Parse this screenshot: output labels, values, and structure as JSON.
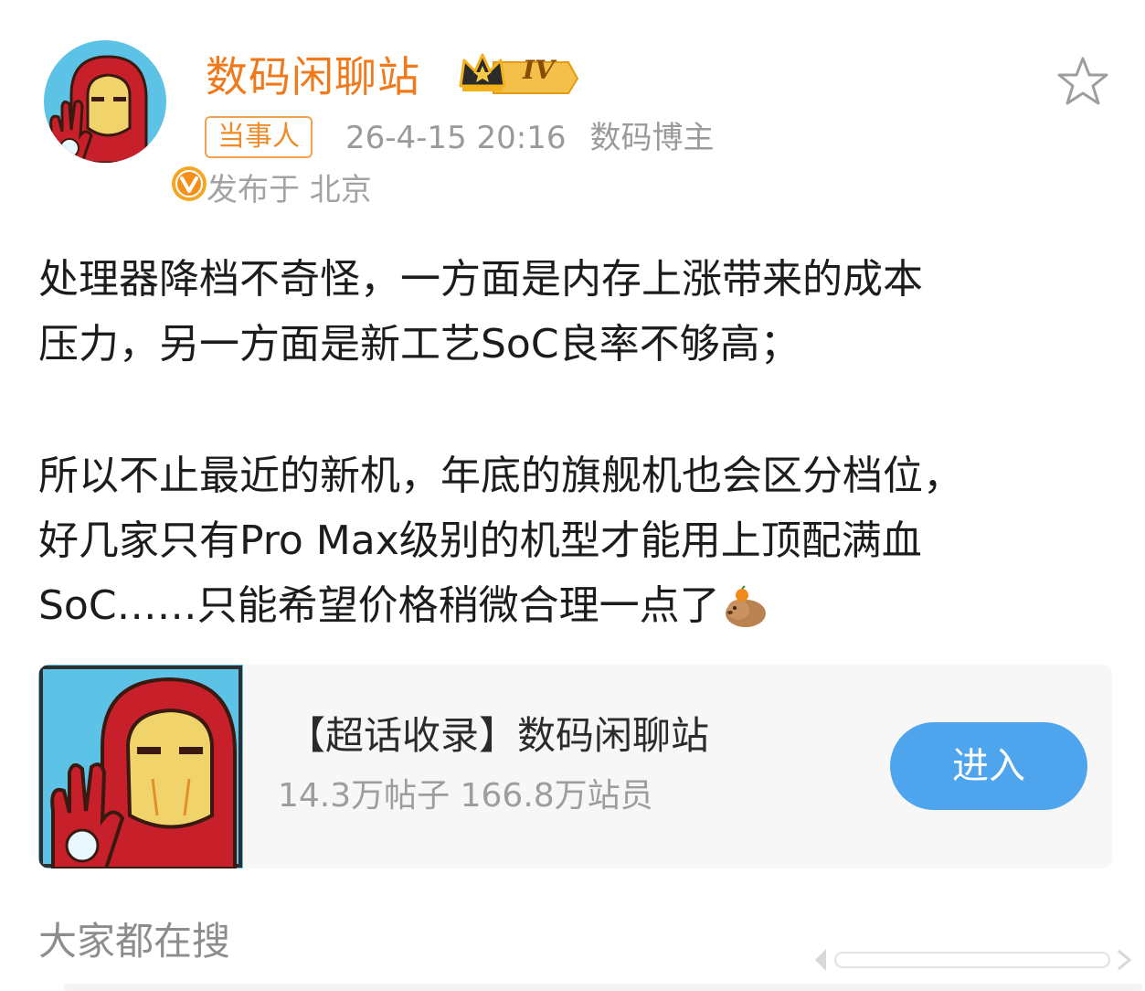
{
  "post": {
    "author": {
      "name": "数码闲聊站",
      "level_badge": "IV",
      "role_tag": "当事人"
    },
    "timestamp": "26-4-15 20:16",
    "source": "数码博主",
    "location": "发布于 北京",
    "paragraphs": [
      [
        "处理器降档不奇怪，一方面是内存上涨带来的成本",
        "压力，另一方面是新工艺SoC良率不够高；"
      ],
      [
        "所以不止最近的新机，年底的旗舰机也会区分档位，",
        "好几家只有Pro Max级别的机型才能用上顶配满血",
        "SoC……只能希望价格稍微合理一点了"
      ]
    ]
  },
  "supertopic_card": {
    "title": "【超话收录】数码闲聊站",
    "stats": "14.3万帖子 166.8万站员",
    "enter_label": "进入"
  },
  "trending": {
    "title": "大家都在搜"
  },
  "colors": {
    "username": "#f07a1b",
    "role_tag": "#ee8b2a",
    "enter_button": "#4ea5ee",
    "card_bg": "#f7f7f7"
  },
  "icons": [
    "avatar-ironman",
    "verified-v-icon",
    "crown-level-icon",
    "star-icon",
    "capybara-emoji"
  ]
}
